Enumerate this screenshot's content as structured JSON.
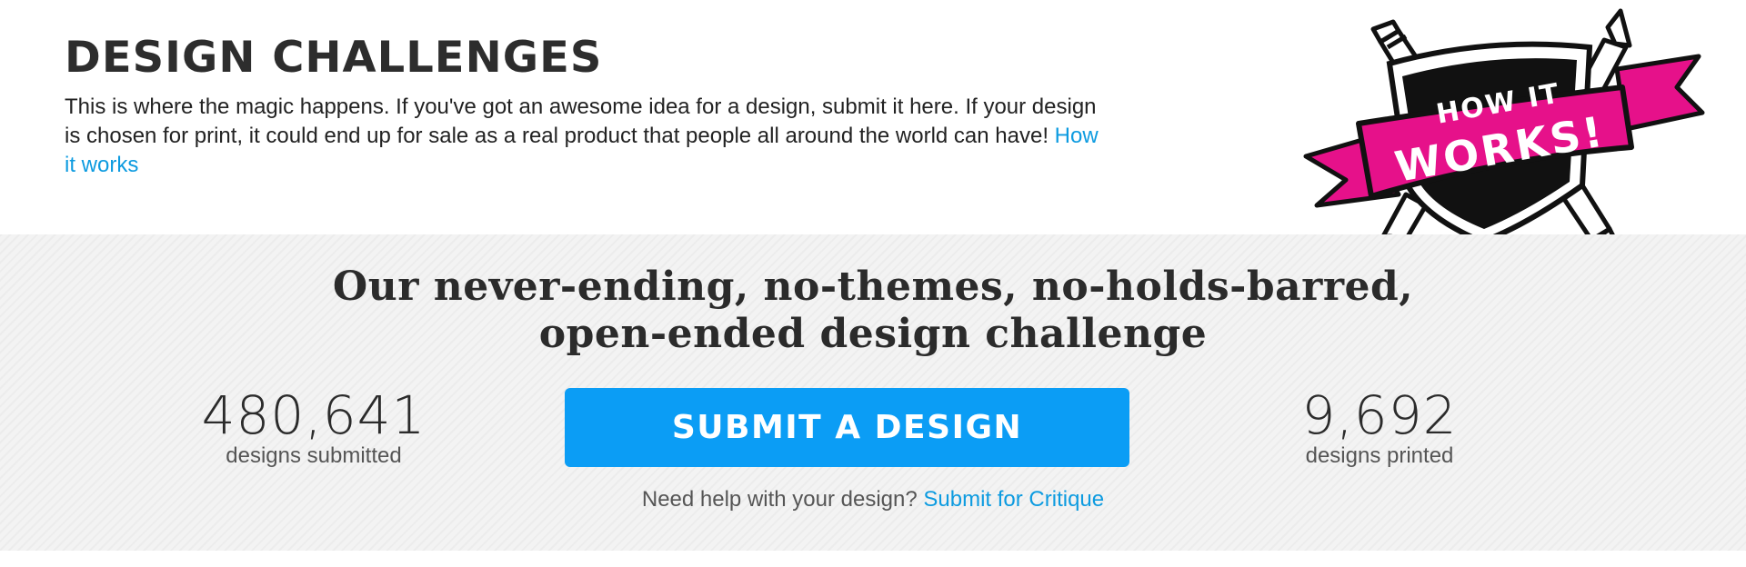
{
  "header": {
    "title": "DESIGN CHALLENGES",
    "description": "This is where the magic happens. If you've got an awesome idea for a design, submit it here. If your design is chosen for print, it could end up for sale as a real product that people all around the world can have!",
    "how_it_works_link": "How it works"
  },
  "badge": {
    "line1": "HOW IT",
    "line2": "WORKS!",
    "colors": {
      "ribbon": "#e6118a",
      "shield": "#111111",
      "outline": "#111111"
    }
  },
  "main": {
    "headline_line1": "Our never-ending, no-themes, no-holds-barred,",
    "headline_line2": "open-ended design challenge",
    "stats": {
      "submitted_value": "480,641",
      "submitted_label": "designs submitted",
      "printed_value": "9,692",
      "printed_label": "designs printed"
    },
    "submit_button_label": "SUBMIT A DESIGN",
    "help_text": "Need help with your design?",
    "critique_link": "Submit for Critique",
    "accent_color": "#0b9df5",
    "link_color": "#0d9be0"
  }
}
